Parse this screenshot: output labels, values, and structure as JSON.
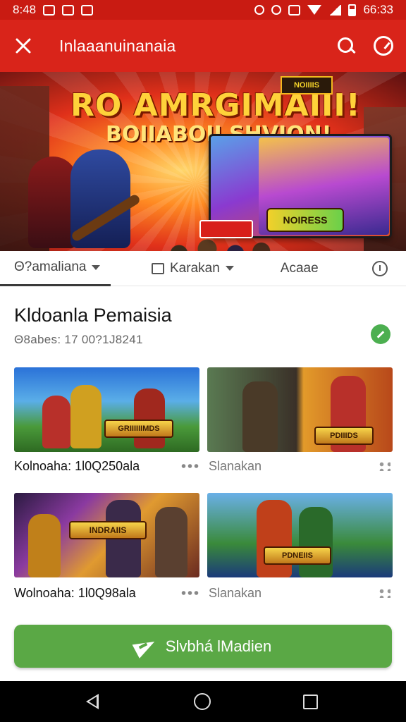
{
  "status_bar": {
    "time": "8:48",
    "clock_right": "66:33",
    "left_icons": [
      "photo-icon",
      "notification-icon",
      "notification-icon"
    ],
    "right_icons": [
      "mute-icon",
      "alarm-icon",
      "notification-icon",
      "wifi-icon",
      "signal-icon",
      "battery-icon"
    ]
  },
  "app_bar": {
    "title": "Inlaaanuinanaia",
    "left_icon": "close-icon",
    "right_icons": [
      "search-icon",
      "timer-icon"
    ],
    "color": "#d9241a"
  },
  "banner": {
    "title": "RO AMRGIMAIII!",
    "subtitle": "BOIIABOII SHVION!",
    "card_logo_text": "NOIIIIS",
    "card_badge_text": "NOIRESS"
  },
  "tabs": [
    {
      "label": "Θ?amaliana",
      "icon": "chevron-down-icon",
      "active": true
    },
    {
      "label": "Karakan",
      "icon": "chat-icon",
      "active": false
    },
    {
      "label": "Acaae",
      "active": false
    },
    {
      "label": "",
      "icon": "info-icon",
      "active": false
    }
  ],
  "section": {
    "title": "Kldoanla Pemaisia",
    "subtitle": "Θ8abes: 17 00?1J8241",
    "badge_icon": "check-icon",
    "badge_color": "#4caf50"
  },
  "cards": [
    {
      "image_text": "GRIIIIIIMDS",
      "label": "Kolnoaha: 1l0Q250ala",
      "menu_icon": "more-icon"
    },
    {
      "image_text": "PDIIIDS",
      "label": "Slanakan",
      "menu_icon": "grid-icon"
    },
    {
      "image_text": "INDRAIIS",
      "label": "Wolnoaha: 1l0Q98ala",
      "menu_icon": "more-icon"
    },
    {
      "image_text": "PDNEIIS",
      "label": "Slanakan",
      "menu_icon": "grid-icon"
    }
  ],
  "cta": {
    "label": "Slvbhá lMadien",
    "icon": "send-icon",
    "color": "#5aa845"
  },
  "nav_bar": {
    "icons": [
      "back-icon",
      "home-icon",
      "recents-icon"
    ]
  }
}
